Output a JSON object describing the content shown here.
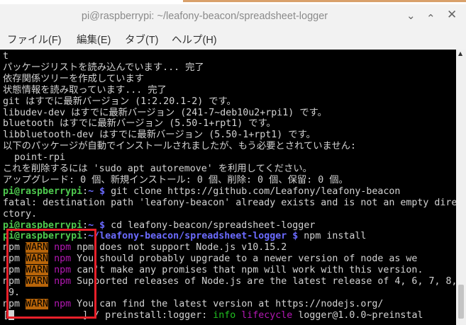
{
  "window": {
    "title": "pi@raspberrypi: ~/leafony-beacon/spreadsheet-logger"
  },
  "menu": [
    "ファイル(F)",
    "編集(E)",
    "タブ(T)",
    "ヘルプ(H)"
  ],
  "icons": {
    "minimize": "chevron-down-icon",
    "maximize": "chevron-up-icon",
    "close": "close-icon"
  },
  "terminal": {
    "lines": [
      [
        {
          "t": "t"
        }
      ],
      [
        {
          "t": "パッケージリストを読み込んでいます... 完了"
        }
      ],
      [
        {
          "t": "依存関係ツリーを作成しています"
        }
      ],
      [
        {
          "t": "状態情報を読み取っています... 完了"
        }
      ],
      [
        {
          "t": "git はすでに最新バージョン (1:2.20.1-2) です。"
        }
      ],
      [
        {
          "t": "libudev-dev はすでに最新バージョン (241-7~deb10u2+rpi1) です。"
        }
      ],
      [
        {
          "t": "bluetooth はすでに最新バージョン (5.50-1+rpt1) です。"
        }
      ],
      [
        {
          "t": "libbluetooth-dev はすでに最新バージョン (5.50-1+rpt1) です。"
        }
      ],
      [
        {
          "t": "以下のパッケージが自動でインストールされましたが、もう必要とされていません:"
        }
      ],
      [
        {
          "t": "  point-rpi"
        }
      ],
      [
        {
          "t": "これを削除するには 'sudo apt autoremove' を利用してください。"
        }
      ],
      [
        {
          "t": "アップグレード: 0 個、新規インストール: 0 個、削除: 0 個、保留: 0 個。"
        }
      ],
      [
        {
          "t": "pi@raspberrypi",
          "c": "g"
        },
        {
          "t": ":"
        },
        {
          "t": "~ $",
          "c": "b"
        },
        {
          "t": " git clone https://github.com/Leafony/leafony-beacon"
        }
      ],
      [
        {
          "t": "fatal: destination path 'leafony-beacon' already exists and is not an empty dire"
        }
      ],
      [
        {
          "t": "ctory."
        }
      ],
      [
        {
          "t": "pi@raspberrypi",
          "c": "g"
        },
        {
          "t": ":"
        },
        {
          "t": "~ $",
          "c": "b"
        },
        {
          "t": " cd leafony-beacon/spreadsheet-logger"
        }
      ],
      [
        {
          "t": "pi@raspberrypi",
          "c": "g"
        },
        {
          "t": ":"
        },
        {
          "t": "~/leafony-beacon/spreadsheet-logger $",
          "c": "b"
        },
        {
          "t": " npm install"
        }
      ],
      [
        {
          "t": "npm "
        },
        {
          "t": "WARN",
          "c": "warn"
        },
        {
          "t": " "
        },
        {
          "t": "npm",
          "c": "mag"
        },
        {
          "t": " npm does not support Node.js v10.15.2"
        }
      ],
      [
        {
          "t": "npm "
        },
        {
          "t": "WARN",
          "c": "warn"
        },
        {
          "t": " "
        },
        {
          "t": "npm",
          "c": "mag"
        },
        {
          "t": " You should probably upgrade to a newer version of node as we"
        }
      ],
      [
        {
          "t": "npm "
        },
        {
          "t": "WARN",
          "c": "warn"
        },
        {
          "t": " "
        },
        {
          "t": "npm",
          "c": "mag"
        },
        {
          "t": " can't make any promises that npm will work with this version."
        }
      ],
      [
        {
          "t": "npm "
        },
        {
          "t": "WARN",
          "c": "warn"
        },
        {
          "t": " "
        },
        {
          "t": "npm",
          "c": "mag"
        },
        {
          "t": " Supported releases of Node.js are the latest release of 4, 6, 7, 8,"
        }
      ],
      [
        {
          "t": " 9."
        }
      ],
      [
        {
          "t": "npm "
        },
        {
          "t": "WARN",
          "c": "warn"
        },
        {
          "t": " "
        },
        {
          "t": "npm",
          "c": "mag"
        },
        {
          "t": " You can find the latest version at https://nodejs.org/"
        }
      ],
      [
        {
          "t": "["
        },
        {
          "t": "",
          "c": "cursor"
        },
        {
          "t": "          ..] / preinstall:logger: "
        },
        {
          "t": "info",
          "c": "grn"
        },
        {
          "t": " "
        },
        {
          "t": "lifecycle",
          "c": "mag"
        },
        {
          "t": " logger@1.0.0~preinstal"
        }
      ]
    ]
  },
  "colors": {
    "highlight_box": "#e8202a",
    "prompt_user": "#4ec94e",
    "prompt_path": "#6b6bff",
    "warn_bg": "#b8650a",
    "npm": "#b418b4"
  }
}
